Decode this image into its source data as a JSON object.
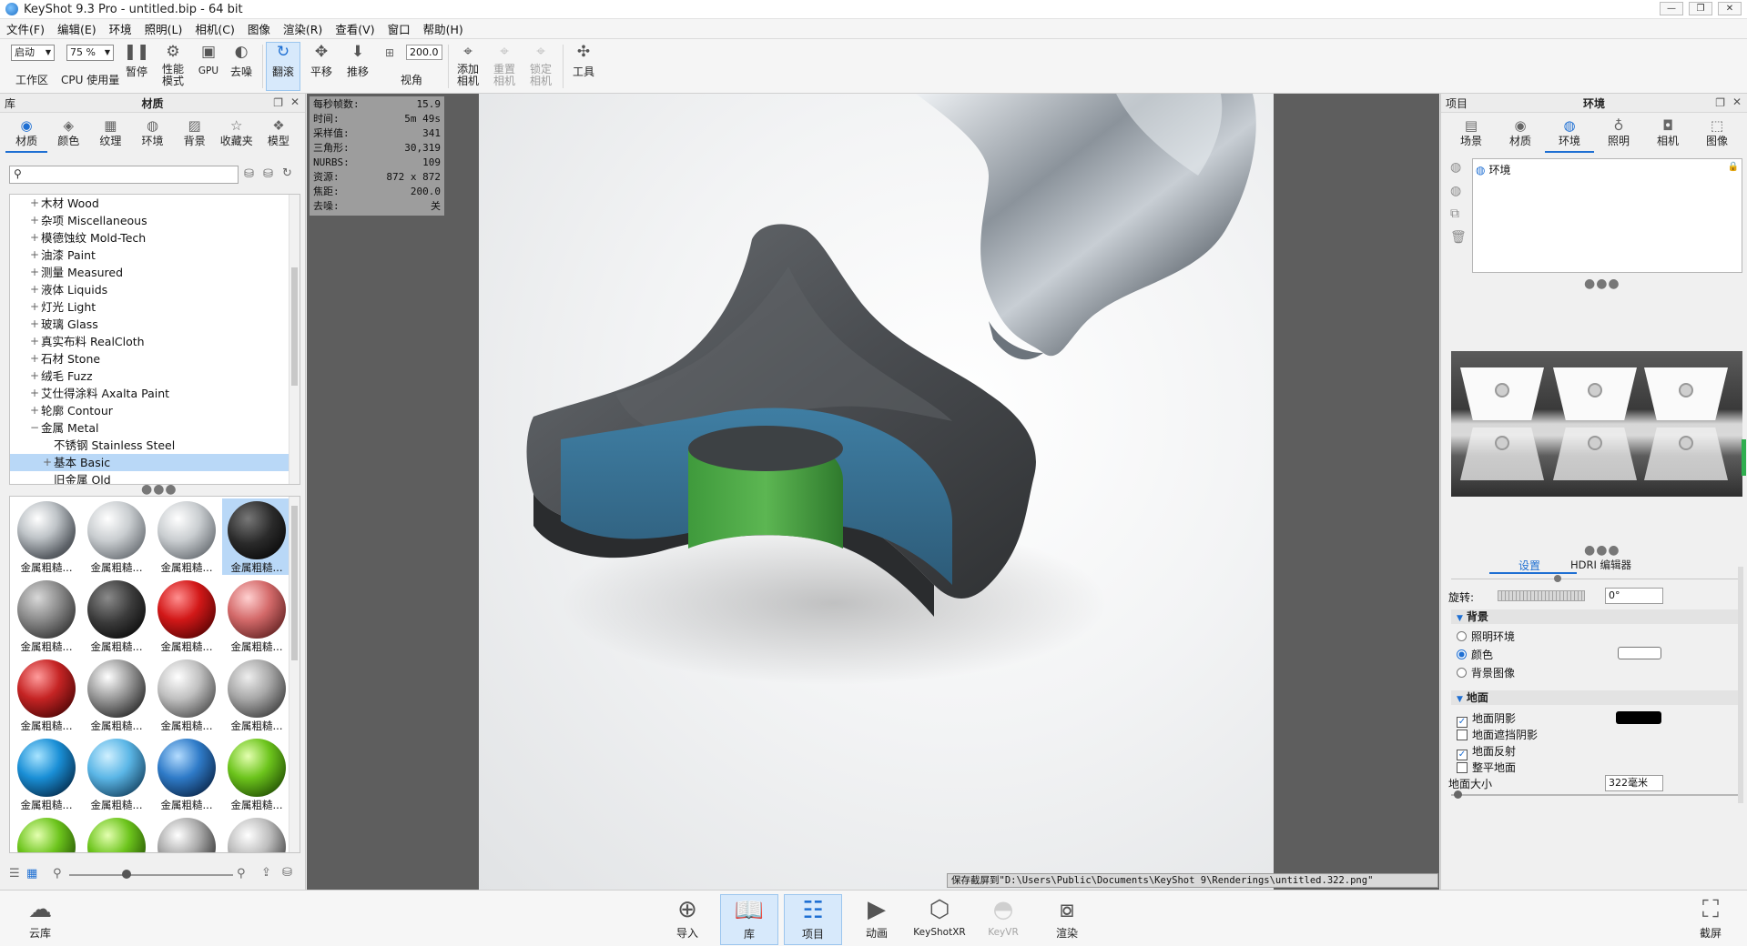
{
  "window": {
    "title": "KeyShot 9.3 Pro  - untitled.bip  - 64 bit",
    "controls": [
      "—",
      "❐",
      "✕"
    ]
  },
  "menu": [
    "文件(F)",
    "编辑(E)",
    "环境",
    "照明(L)",
    "相机(C)",
    "图像",
    "渲染(R)",
    "查看(V)",
    "窗口",
    "帮助(H)"
  ],
  "toolbar": {
    "workspace_select": "启动",
    "workspace_label": "工作区",
    "cpu_select": "75 %",
    "cpu_label": "CPU 使用量",
    "pause": "暂停",
    "perf_mode": "性能\n模式",
    "gpu": "GPU",
    "denoise": "去噪",
    "tumble": "翻滚",
    "pan": "平移",
    "dolly": "推移",
    "fov_value": "200.0",
    "fov_label": "视角",
    "add_camera": "添加\n相机",
    "reset_camera": "重置\n相机",
    "lock_camera": "锁定\n相机",
    "tools": "工具"
  },
  "library": {
    "header_left": "库",
    "header_title": "材质",
    "tabs": [
      "材质",
      "颜色",
      "纹理",
      "环境",
      "背景",
      "收藏夹",
      "模型"
    ],
    "tree": [
      {
        "label": "木材 Wood",
        "exp": "+",
        "level": 0
      },
      {
        "label": "杂项 Miscellaneous",
        "exp": "+",
        "level": 0
      },
      {
        "label": "模德蚀纹 Mold-Tech",
        "exp": "+",
        "level": 0
      },
      {
        "label": "油漆 Paint",
        "exp": "+",
        "level": 0
      },
      {
        "label": "测量 Measured",
        "exp": "+",
        "level": 0
      },
      {
        "label": "液体 Liquids",
        "exp": "+",
        "level": 0
      },
      {
        "label": "灯光 Light",
        "exp": "+",
        "level": 0
      },
      {
        "label": "玻璃 Glass",
        "exp": "+",
        "level": 0
      },
      {
        "label": "真实布料 RealCloth",
        "exp": "+",
        "level": 0
      },
      {
        "label": "石材 Stone",
        "exp": "+",
        "level": 0
      },
      {
        "label": "绒毛 Fuzz",
        "exp": "+",
        "level": 0
      },
      {
        "label": "艾仕得涂料 Axalta Paint",
        "exp": "+",
        "level": 0
      },
      {
        "label": "轮廓 Contour",
        "exp": "+",
        "level": 0
      },
      {
        "label": "金属 Metal",
        "exp": "−",
        "level": 0
      },
      {
        "label": "不锈钢 Stainless Steel",
        "exp": "",
        "level": 1
      },
      {
        "label": "基本 Basic",
        "exp": "+",
        "level": 1,
        "selected": true
      },
      {
        "label": "旧金属 Old",
        "exp": "",
        "level": 1
      }
    ],
    "thumb_caption": "金属粗糙..."
  },
  "stats": [
    {
      "k": "每秒帧数:",
      "v": "15.9"
    },
    {
      "k": "时间:",
      "v": "5m 49s"
    },
    {
      "k": "采样值:",
      "v": "341"
    },
    {
      "k": "三角形:",
      "v": "30,319"
    },
    {
      "k": "NURBS:",
      "v": "109"
    },
    {
      "k": "资源:",
      "v": "872 x 872"
    },
    {
      "k": "焦距:",
      "v": "200.0"
    },
    {
      "k": "去噪:",
      "v": "关"
    }
  ],
  "status_message": "保存截屏到\"D:\\Users\\Public\\Documents\\KeyShot 9\\Renderings\\untitled.322.png\"",
  "project": {
    "header_left": "项目",
    "header_title": "环境",
    "tabs": [
      "场景",
      "材质",
      "环境",
      "照明",
      "相机",
      "图像"
    ],
    "env_item": "环境",
    "subtabs": [
      "设置",
      "HDRI 编辑器"
    ],
    "rotation_label": "旋转:",
    "rotation_value": "0°",
    "background_head": "背景",
    "bg_options": [
      "照明环境",
      "颜色",
      "背景图像"
    ],
    "ground_head": "地面",
    "ground_options": [
      "地面阴影",
      "地面遮挡阴影",
      "地面反射",
      "整平地面"
    ],
    "ground_size_label": "地面大小",
    "ground_size_value": "322毫米",
    "colors": {
      "background_color": "#ffffff",
      "shadow_color": "#000000"
    }
  },
  "bottom": {
    "cloud": "云库",
    "import": "导入",
    "library": "库",
    "project": "项目",
    "animation": "动画",
    "keyshotxr": "KeyShotXR",
    "keyvr": "KeyVR",
    "render": "渲染",
    "screenshot": "截屏"
  },
  "accent": "#1e6fd3"
}
